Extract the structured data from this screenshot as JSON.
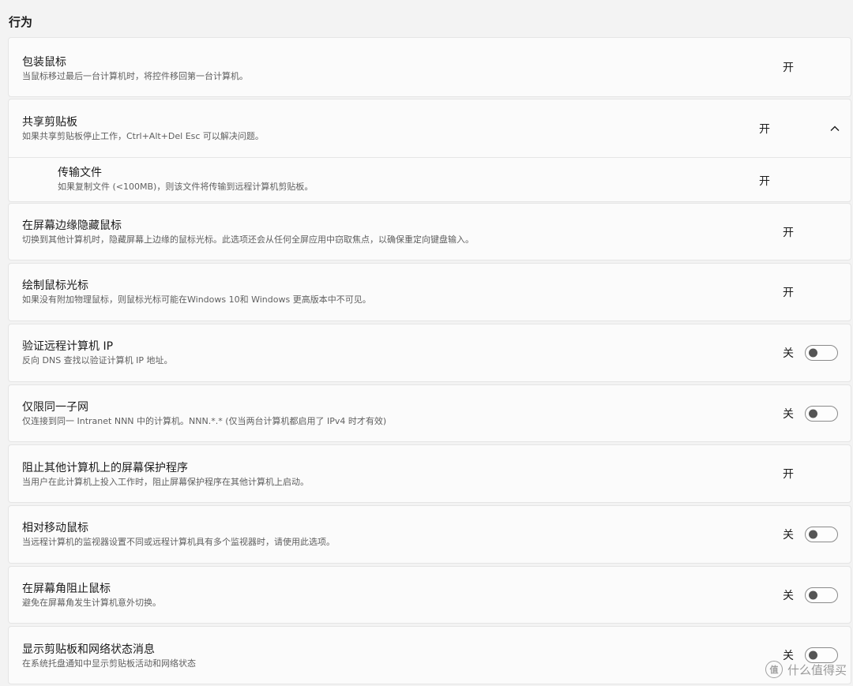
{
  "section": {
    "title": "行为"
  },
  "settings": [
    {
      "label": "包装鼠标",
      "desc": "当鼠标移过最后一台计算机时，将控件移回第一台计算机。",
      "state": "开",
      "on": true
    },
    {
      "label": "共享剪贴板",
      "desc": "如果共享剪贴板停止工作，Ctrl+Alt+Del Esc 可以解决问题。",
      "state": "开",
      "on": true
    },
    {
      "label": "传输文件",
      "desc": "如果复制文件 (<100MB)，则该文件将传输到远程计算机剪贴板。",
      "state": "开",
      "on": true
    },
    {
      "label": "在屏幕边缘隐藏鼠标",
      "desc": "切换到其他计算机时，隐藏屏幕上边缘的鼠标光标。此选项还会从任何全屏应用中窃取焦点，以确保重定向键盘输入。",
      "state": "开",
      "on": true
    },
    {
      "label": "绘制鼠标光标",
      "desc": "如果没有附加物理鼠标，则鼠标光标可能在Windows 10和 Windows 更高版本中不可见。",
      "state": "开",
      "on": true
    },
    {
      "label": "验证远程计算机 IP",
      "desc": "反向 DNS 查找以验证计算机 IP 地址。",
      "state": "关",
      "on": false
    },
    {
      "label": "仅限同一子网",
      "desc": "仅连接到同一 Intranet NNN 中的计算机。NNN.*.* (仅当两台计算机都启用了 IPv4 时才有效)",
      "state": "关",
      "on": false
    },
    {
      "label": "阻止其他计算机上的屏幕保护程序",
      "desc": "当用户在此计算机上投入工作时，阻止屏幕保护程序在其他计算机上启动。",
      "state": "开",
      "on": true
    },
    {
      "label": "相对移动鼠标",
      "desc": "当远程计算机的监视器设置不同或远程计算机具有多个监视器时，请使用此选项。",
      "state": "关",
      "on": false
    },
    {
      "label": "在屏幕角阻止鼠标",
      "desc": "避免在屏幕角发生计算机意外切换。",
      "state": "关",
      "on": false
    },
    {
      "label": "显示剪贴板和网络状态消息",
      "desc": "在系统托盘通知中显示剪贴板活动和网络状态",
      "state": "关",
      "on": false
    }
  ],
  "watermark": {
    "text": "什么值得买",
    "badge": "值"
  }
}
